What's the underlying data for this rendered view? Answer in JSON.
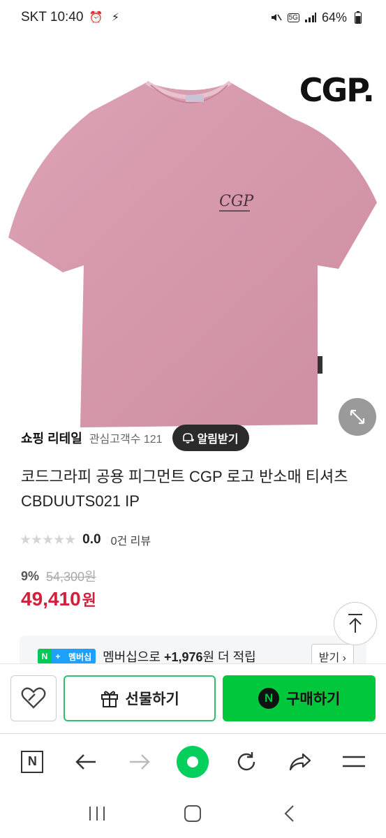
{
  "status": {
    "carrier_time": "SKT 10:40",
    "battery": "64%",
    "network": "5G"
  },
  "product": {
    "brand_logo": "CGP.",
    "shirt_logo": "CGP",
    "seller_name": "쇼핑 리테일",
    "seller_fav": "관심고객수 121",
    "alarm_label": "알림받기",
    "title": "코드그라피 공용 피그먼트 CGP 로고 반소매 티셔츠 CBDUUTS021 IP",
    "stars": "★★★★★",
    "rating": "0.0",
    "review_count": "0건 리뷰",
    "discount_rate": "9%",
    "original_price": "54,300원",
    "price": "49,410",
    "price_unit": "원"
  },
  "membership": {
    "badge_n": "N",
    "badge_plus": "+",
    "badge_text": "멤버십",
    "text_prefix": "멤버십으로 ",
    "points": "+1,976",
    "text_suffix": "원 더 적립",
    "receive_label": "받기 ›"
  },
  "actions": {
    "gift_label": "선물하기",
    "buy_label": "구매하기",
    "buy_icon_letter": "N"
  },
  "browser": {
    "n_label": "N"
  },
  "colors": {
    "price_red": "#d11f3c",
    "naver_green": "#03c75a",
    "membership_blue": "#1ea0ff",
    "shirt_pink": "#d99aae"
  }
}
